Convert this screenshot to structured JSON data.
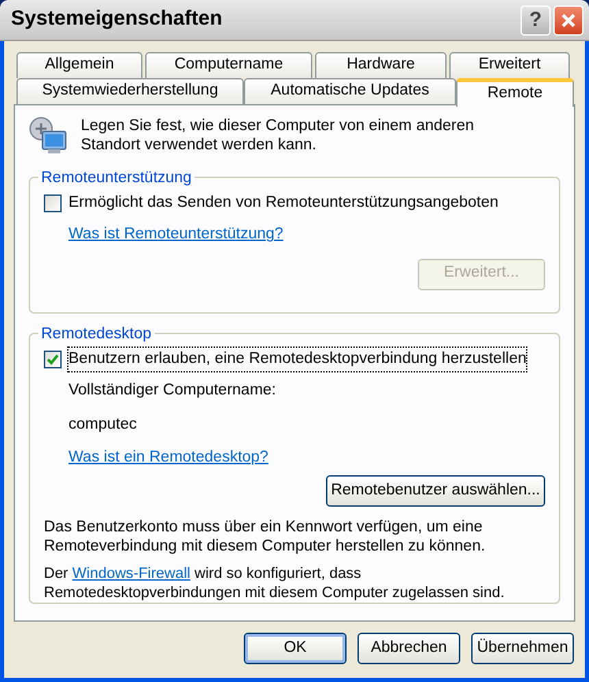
{
  "window": {
    "title": "Systemeigenschaften",
    "buttons": [
      {
        "kind": "help",
        "label": "?"
      },
      {
        "kind": "close"
      }
    ]
  },
  "tab_rows": [
    [
      {
        "label": "Allgemein",
        "selected": false
      },
      {
        "label": "Computername",
        "selected": false
      },
      {
        "label": "Hardware",
        "selected": false
      },
      {
        "label": "Erweitert",
        "selected": false
      }
    ],
    [
      {
        "label": "Systemwiederherstellung",
        "selected": false
      },
      {
        "label": "Automatische Updates",
        "selected": false
      },
      {
        "label": "Remote",
        "selected": true
      }
    ]
  ],
  "intro": "Legen Sie fest, wie dieser Computer von einem anderen Standort verwendet werden kann.",
  "remote_assistance": {
    "title": "Remoteunterstützung",
    "checkbox": {
      "label": "Ermöglicht das Senden von Remoteunterstützungsangeboten",
      "checked": false
    },
    "link": "Was ist Remoteunterstützung?",
    "button": {
      "label": "Erweitert...",
      "disabled": true
    }
  },
  "remote_desktop": {
    "title": "Remotedesktop",
    "checkbox": {
      "label": "Benutzern erlauben, eine Remotedesktopverbindung herzustellen",
      "checked": true
    },
    "name_label": "Vollständiger Computername:",
    "name_value": "computec",
    "link": "Was ist ein Remotedesktop?",
    "button": {
      "label": "Remotebenutzer auswählen...",
      "disabled": false
    },
    "note": "Das Benutzerkonto muss über ein Kennwort verfügen, um eine Remoteverbindung mit diesem Computer herstellen zu können.",
    "firewall_note": {
      "before": "Der ",
      "link": "Windows-Firewall",
      "after": " wird so konfiguriert, dass Remotedesktopverbindungen mit diesem Computer zugelassen sind."
    }
  },
  "buttons": [
    {
      "label": "OK",
      "default": true
    },
    {
      "label": "Abbrechen",
      "default": false
    },
    {
      "label": "Übernehmen",
      "default": false
    }
  ]
}
